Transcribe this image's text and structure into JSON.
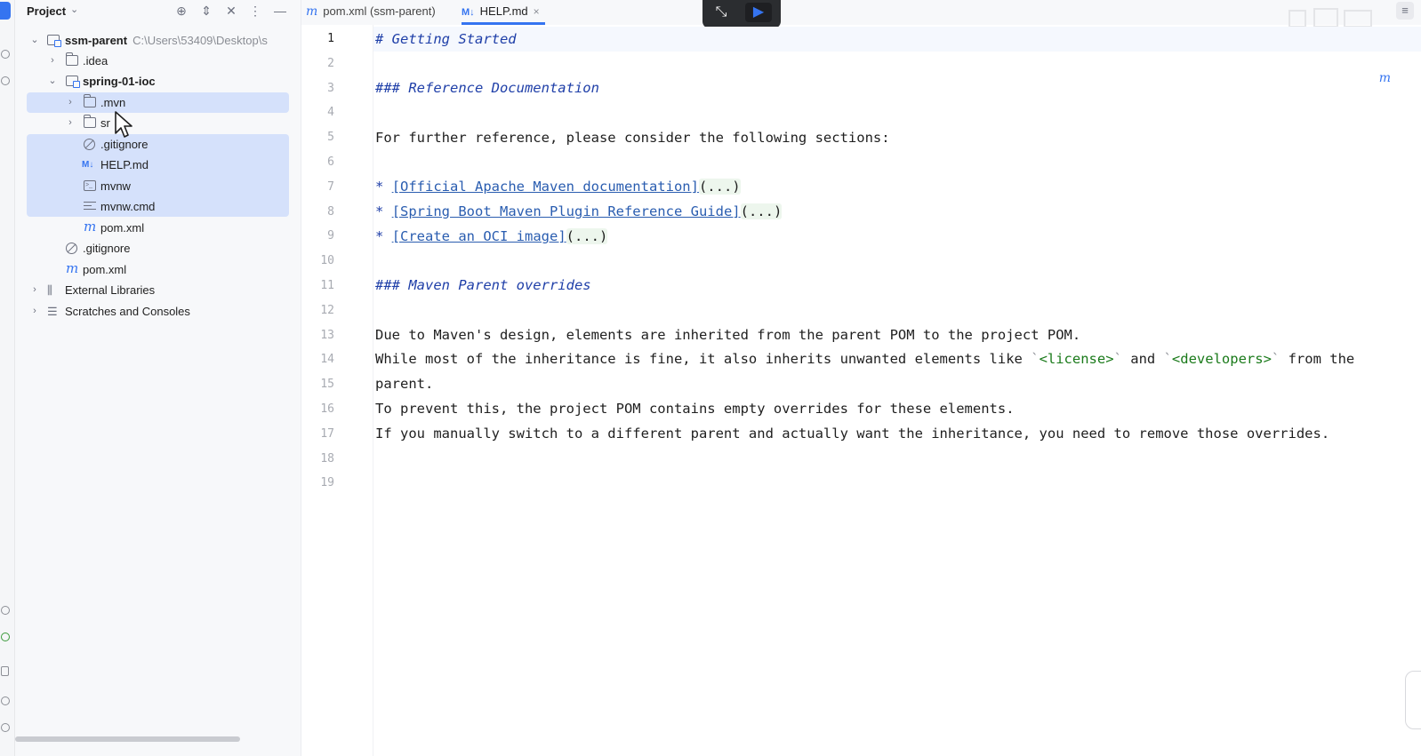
{
  "project_panel": {
    "title": "Project",
    "tree": [
      {
        "label": "ssm-parent",
        "path": "C:\\Users\\53409\\Desktop\\s"
      },
      {
        "label": ".idea"
      },
      {
        "label": "spring-01-ioc"
      },
      {
        "label": ".mvn"
      },
      {
        "label": "sr"
      },
      {
        "label": ".gitignore"
      },
      {
        "label": "HELP.md",
        "icon_text": "M↓"
      },
      {
        "label": "mvnw"
      },
      {
        "label": "mvnw.cmd"
      },
      {
        "label": "pom.xml",
        "icon_text": "m"
      },
      {
        "label": ".gitignore"
      },
      {
        "label": "pom.xml",
        "icon_text": "m"
      },
      {
        "label": "External Libraries"
      },
      {
        "label": "Scratches and Consoles"
      }
    ]
  },
  "tabs": [
    {
      "icon_text": "m",
      "label": "pom.xml (ssm-parent)"
    },
    {
      "icon_text": "M↓",
      "label": "HELP.md",
      "close": "×"
    }
  ],
  "editor": {
    "line_numbers": [
      "1",
      "2",
      "3",
      "4",
      "5",
      "6",
      "7",
      "8",
      "9",
      "10",
      "11",
      "12",
      "13",
      "14",
      "15",
      "16",
      "17",
      "18",
      "19"
    ],
    "l1": "# Getting Started",
    "l3": "### Reference Documentation",
    "l5": "For further reference, please consider the following sections:",
    "bullet": "*",
    "l7_link": "[Official Apache Maven documentation]",
    "l8_link": "[Spring Boot Maven Plugin Reference Guide]",
    "l9_link": "[Create an OCI image]",
    "fold": "(...)",
    "l11": "### Maven Parent overrides",
    "l13": "Due to Maven's design, elements are inherited from the parent POM to the project POM.",
    "l14_a": "While most of the inheritance is fine, it also inherits unwanted elements like ",
    "l14_code1": "<license>",
    "l14_b": " and ",
    "l14_code2": "<developers>",
    "l14_c": " from the",
    "tick": "`",
    "l15": "parent.",
    "l16": "To prevent this, the project POM contains empty overrides for these elements.",
    "l17": "If you manually switch to a different parent and actually want the inheritance, you need to remove those overrides."
  },
  "colors": {
    "accent": "#3574f0",
    "selection": "#d5e1fb",
    "heading": "#1f3fa8",
    "code": "#1a7a1a"
  }
}
